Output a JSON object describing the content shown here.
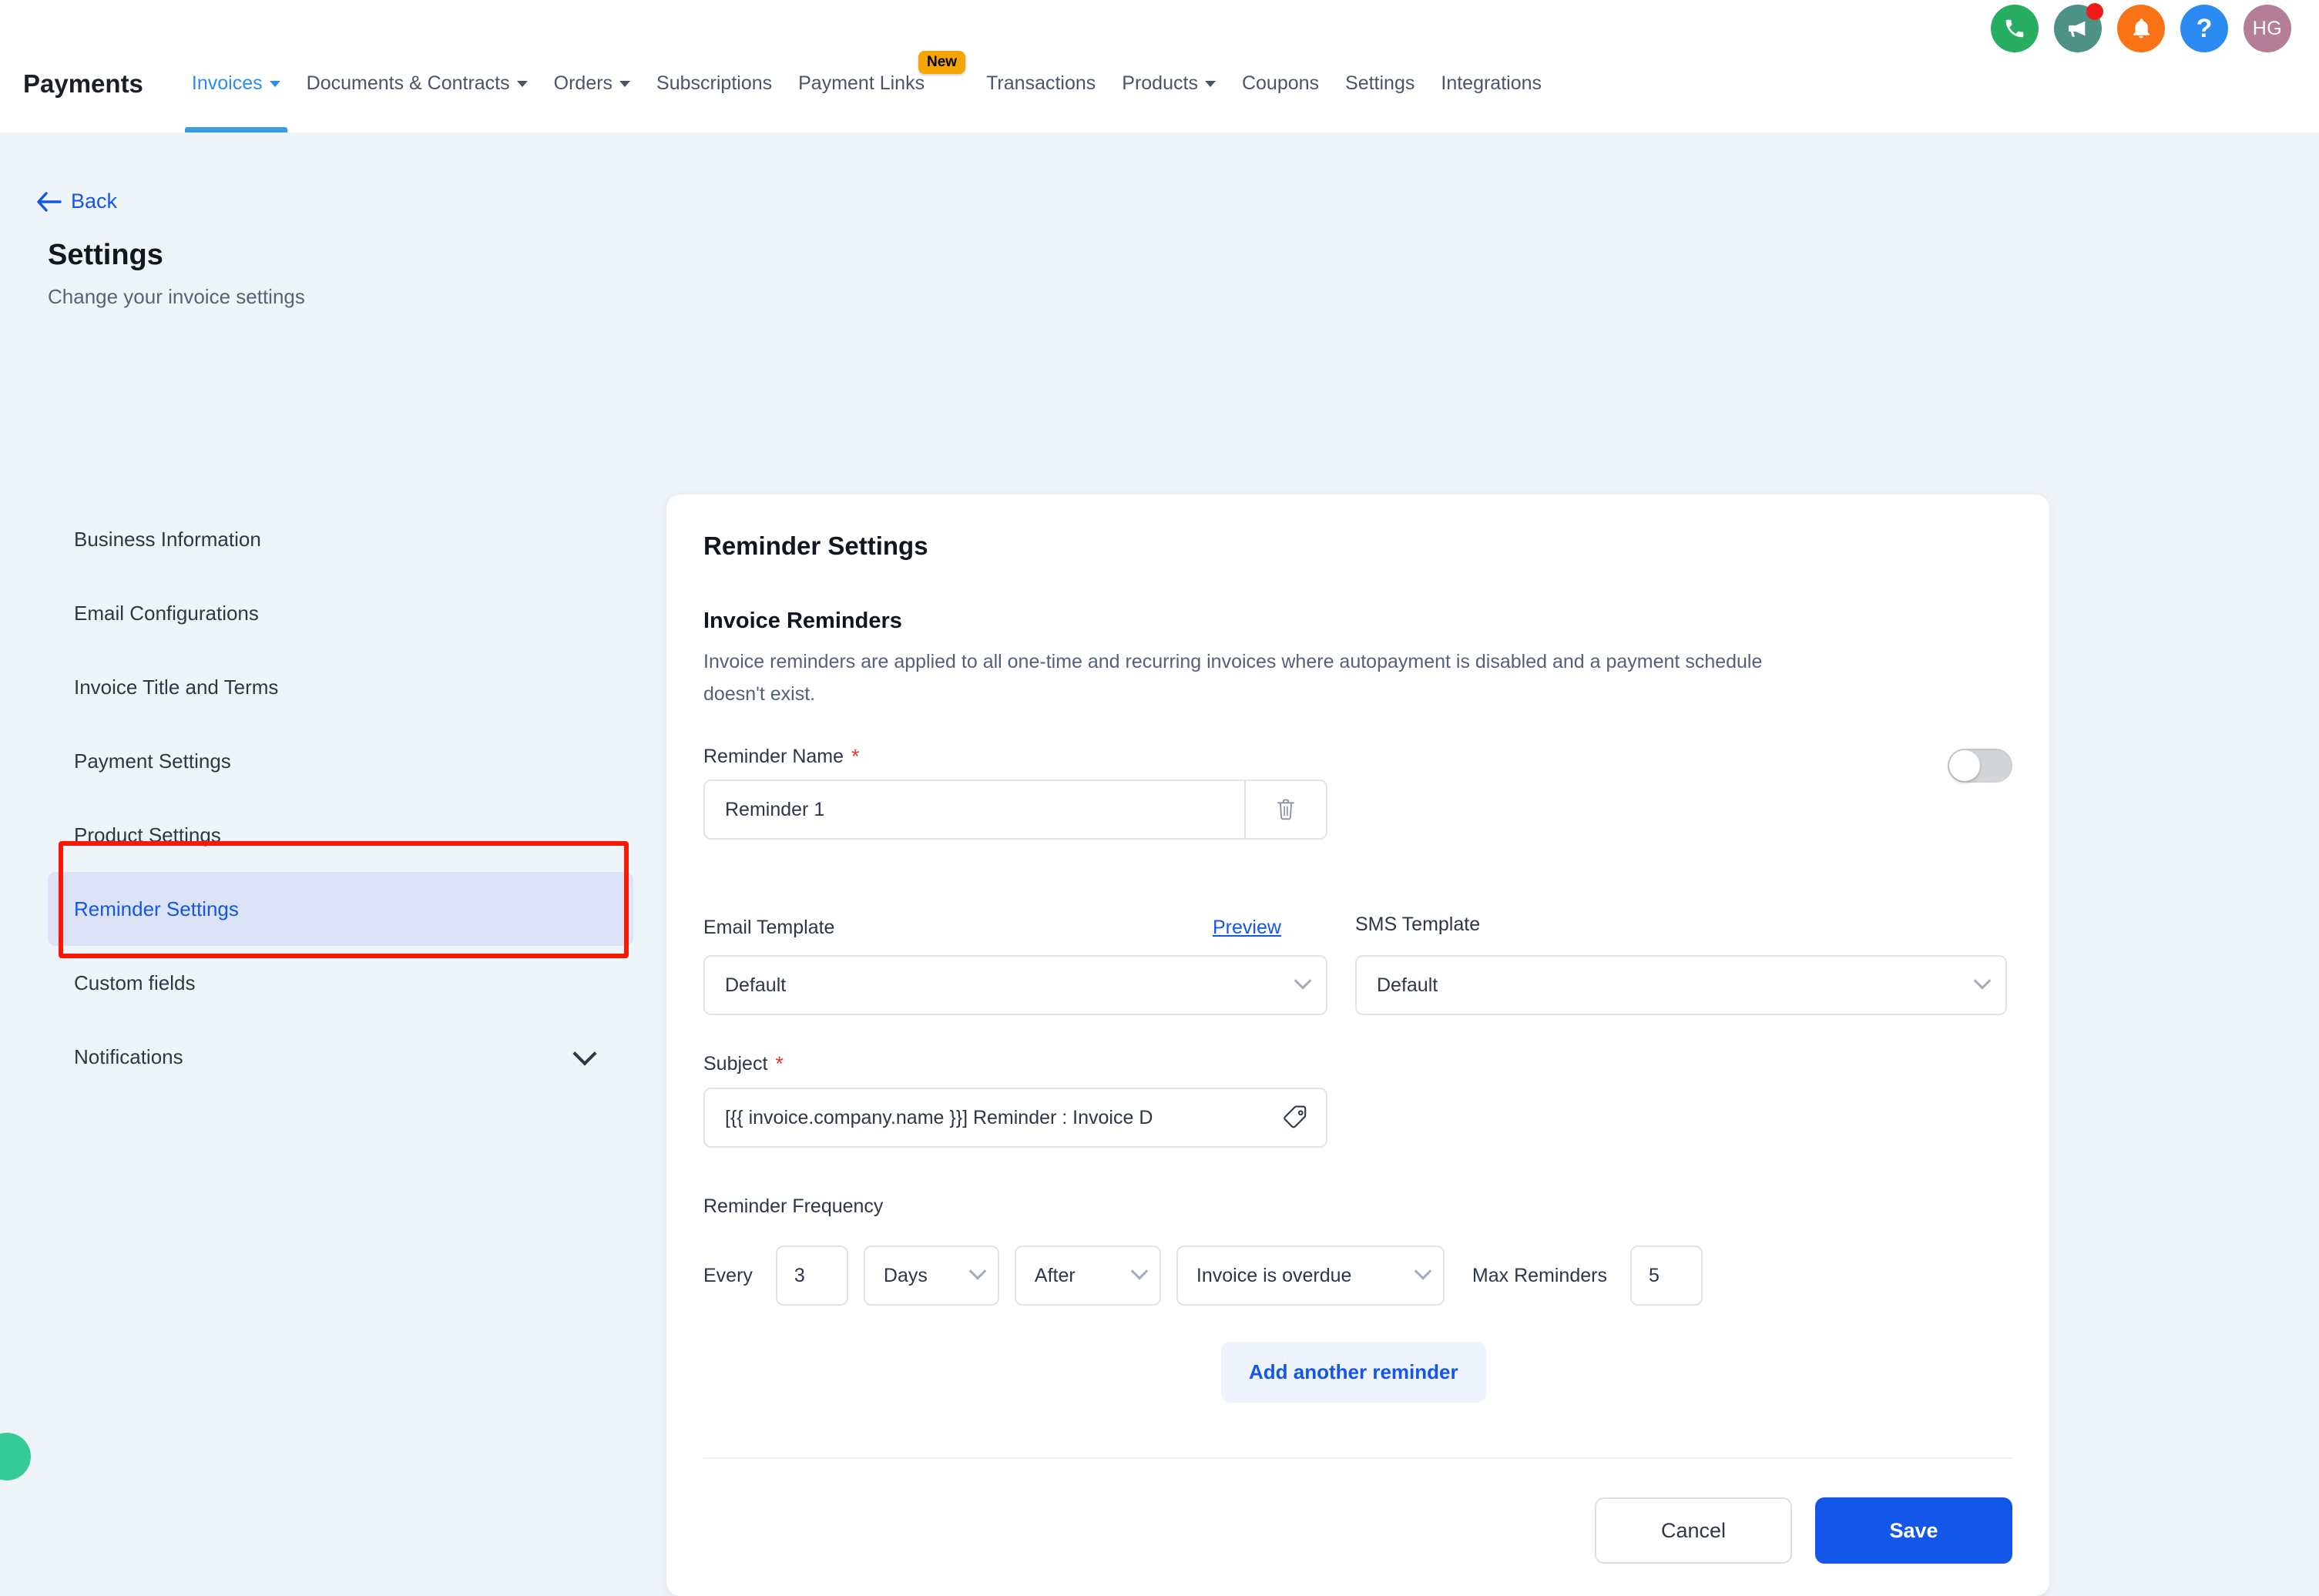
{
  "header": {
    "brand": "Payments",
    "icons": [
      {
        "name": "phone-icon",
        "label": "phone",
        "color": "#27ae60"
      },
      {
        "name": "megaphone-icon",
        "label": "announcements",
        "color": "#4e9187",
        "badge": true
      },
      {
        "name": "bell-icon",
        "label": "notifications",
        "color": "#f97316"
      },
      {
        "name": "help-icon",
        "label": "?",
        "color": "#2b8bf2"
      },
      {
        "name": "avatar",
        "label": "HG",
        "color": "#b47f96"
      }
    ],
    "nav": [
      {
        "label": "Invoices",
        "caret": true,
        "active": true,
        "badge": ""
      },
      {
        "label": "Documents & Contracts",
        "caret": true,
        "active": false,
        "badge": ""
      },
      {
        "label": "Orders",
        "caret": true,
        "active": false,
        "badge": ""
      },
      {
        "label": "Subscriptions",
        "caret": false,
        "active": false,
        "badge": ""
      },
      {
        "label": "Payment Links",
        "caret": false,
        "active": false,
        "badge": "New"
      },
      {
        "label": "Transactions",
        "caret": false,
        "active": false,
        "badge": ""
      },
      {
        "label": "Products",
        "caret": true,
        "active": false,
        "badge": ""
      },
      {
        "label": "Coupons",
        "caret": false,
        "active": false,
        "badge": ""
      },
      {
        "label": "Settings",
        "caret": false,
        "active": false,
        "badge": ""
      },
      {
        "label": "Integrations",
        "caret": false,
        "active": false,
        "badge": ""
      }
    ]
  },
  "page": {
    "back_label": "Back",
    "title": "Settings",
    "subtitle": "Change your invoice settings"
  },
  "sidebar": {
    "items": [
      {
        "label": "Business Information",
        "selected": false,
        "chevron": false
      },
      {
        "label": "Email Configurations",
        "selected": false,
        "chevron": false
      },
      {
        "label": "Invoice Title and Terms",
        "selected": false,
        "chevron": false
      },
      {
        "label": "Payment Settings",
        "selected": false,
        "chevron": false
      },
      {
        "label": "Product Settings",
        "selected": false,
        "chevron": false
      },
      {
        "label": "Reminder Settings",
        "selected": true,
        "chevron": false
      },
      {
        "label": "Custom fields",
        "selected": false,
        "chevron": false
      },
      {
        "label": "Notifications",
        "selected": false,
        "chevron": true
      }
    ]
  },
  "card": {
    "title": "Reminder Settings",
    "section_title": "Invoice Reminders",
    "section_desc": "Invoice reminders are applied to all one-time and recurring invoices where autopayment is disabled and a payment schedule doesn't exist.",
    "reminder_name_label": "Reminder Name",
    "required_mark": "*",
    "reminder_name_value": "Reminder 1",
    "reminder_name_placeholder": "Reminder Name",
    "toggle_state": "off",
    "email_template_label": "Email Template",
    "preview_label": "Preview",
    "email_template_value": "Default",
    "sms_template_label": "SMS Template",
    "sms_template_value": "Default",
    "subject_label": "Subject",
    "subject_value": "[{{ invoice.company.name }}] Reminder : Invoice D",
    "subject_placeholder": "Subject",
    "frequency_label": "Reminder Frequency",
    "every_label": "Every",
    "every_value": "3",
    "unit_value": "Days",
    "when_value": "After",
    "event_value": "Invoice is overdue",
    "max_reminders_label": "Max Reminders",
    "max_reminders_value": "5",
    "add_another_label": "Add another reminder",
    "cancel_label": "Cancel",
    "save_label": "Save"
  },
  "colors": {
    "accent_blue": "#1357e8",
    "nav_active": "#2b8bf2",
    "badge_new": "#f5a600",
    "annotation_red": "#fc1703",
    "page_bg": "#eff4f8",
    "selected_item_bg": "#dce3f7"
  }
}
